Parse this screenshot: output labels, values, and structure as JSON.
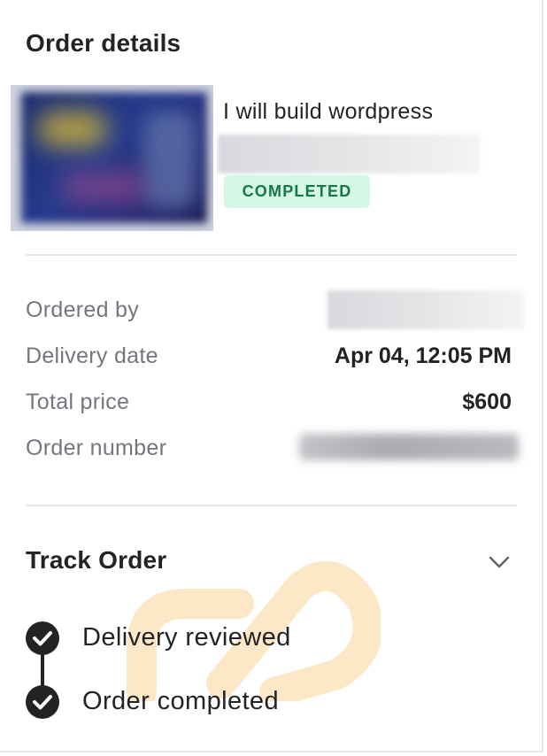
{
  "order": {
    "title": "Order details",
    "gig_title": "I will build wordpress",
    "status": "COMPLETED",
    "status_color": "#137a45",
    "status_bg": "#d6f6e6"
  },
  "details": {
    "ordered_by_label": "Ordered by",
    "delivery_date_label": "Delivery date",
    "delivery_date_value": "Apr 04, 12:05 PM",
    "total_price_label": "Total price",
    "total_price_value": "$600",
    "order_number_label": "Order number"
  },
  "track": {
    "title": "Track Order",
    "toggle_icon": "chevron-down-icon",
    "steps": [
      {
        "label": "Delivery reviewed",
        "icon": "check-circle-icon",
        "done": true
      },
      {
        "label": "Order completed",
        "icon": "check-circle-icon",
        "done": true
      }
    ]
  }
}
